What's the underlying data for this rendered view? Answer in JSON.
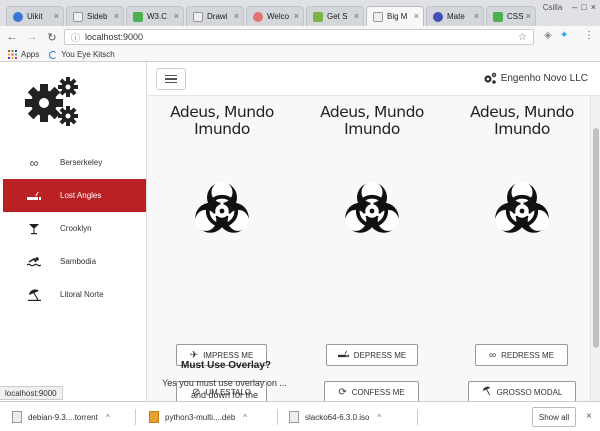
{
  "browser": {
    "tabs": [
      {
        "label": "Uikit",
        "color": "#3b77d8"
      },
      {
        "label": "Sideb",
        "color": "#888888"
      },
      {
        "label": "W3.C",
        "color": "#4caf50"
      },
      {
        "label": "Drawi",
        "color": "#888888"
      },
      {
        "label": "Welco",
        "color": "#e57373"
      },
      {
        "label": "Get S",
        "color": "#7cb342"
      },
      {
        "label": "Big M",
        "color": "#888888"
      },
      {
        "label": "Mate",
        "color": "#3f51b5"
      },
      {
        "label": "CSS",
        "color": "#4caf50"
      }
    ],
    "user": "Csilla",
    "url": "localhost:9000",
    "bookmarks": [
      {
        "label": "Apps"
      },
      {
        "label": "You Eye Kitsch"
      }
    ]
  },
  "sidebar": {
    "items": [
      {
        "label": "Berserkeley",
        "icon": "infinity-icon"
      },
      {
        "label": "Lost Angles",
        "icon": "smoking-icon"
      },
      {
        "label": "Crooklyn",
        "icon": "cocktail-icon"
      },
      {
        "label": "Sambodia",
        "icon": "swimmer-icon"
      },
      {
        "label": "Litoral Norte",
        "icon": "umbrella-beach-icon"
      }
    ]
  },
  "topbar": {
    "brand": "Engenho Novo LLC"
  },
  "columns": [
    {
      "title": "Adeus, Mundo Imundo",
      "buttons": [
        {
          "label": "IMPRESS ME",
          "icon": "plane-icon"
        },
        {
          "label": "UM ESTALO",
          "icon": "ban-icon"
        }
      ]
    },
    {
      "title": "Adeus, Mundo Imundo",
      "buttons": [
        {
          "label": "DEPRESS ME",
          "icon": "smoking-icon"
        },
        {
          "label": "CONFESS ME",
          "icon": "sync-icon"
        }
      ]
    },
    {
      "title": "Adeus, Mundo Imundo",
      "buttons": [
        {
          "label": "REDRESS ME",
          "icon": "infinity-icon"
        },
        {
          "label": "GROSSO MODAL",
          "icon": "umbrella-beach-icon"
        }
      ]
    }
  ],
  "overlay": {
    "title": "Must Use Overlay?",
    "text": "Yes you must use overlay on ... and down for the"
  },
  "status_url": "localhost:9000",
  "downloads": {
    "items": [
      {
        "label": "debian-9.3....torrent"
      },
      {
        "label": "python3-multi....deb"
      },
      {
        "label": "slacko64-6.3.0.iso"
      }
    ],
    "show_all": "Show all"
  },
  "colors": {
    "accent": "#bb2124"
  }
}
